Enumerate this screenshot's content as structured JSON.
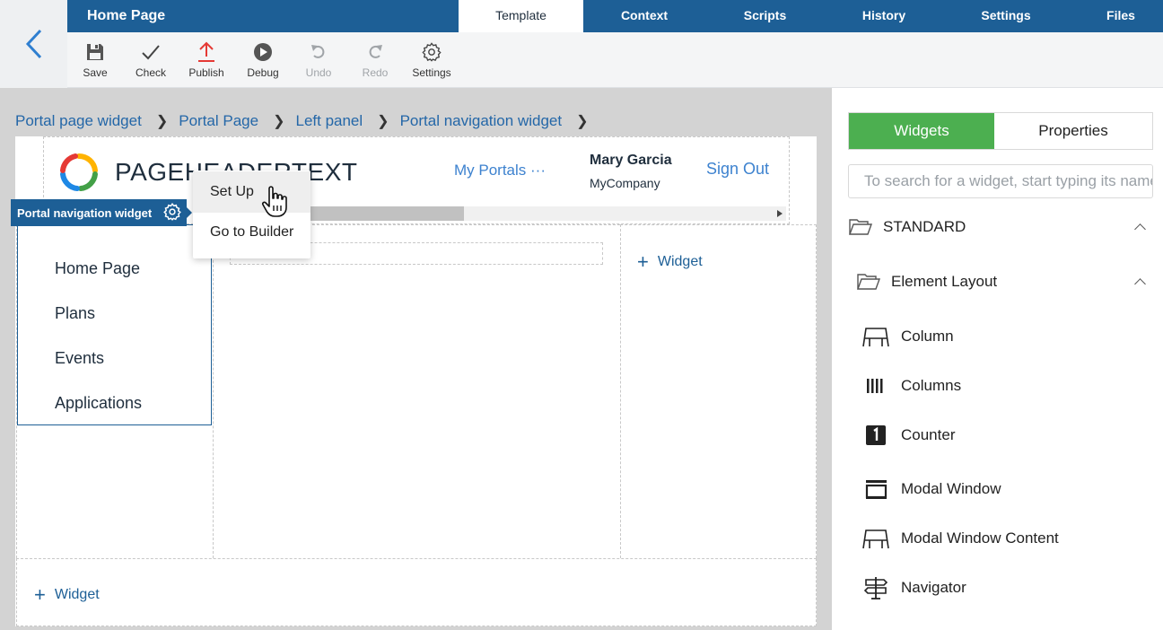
{
  "header": {
    "title": "Home Page",
    "tabs": [
      {
        "label": "Template",
        "active": true
      },
      {
        "label": "Context",
        "active": false
      },
      {
        "label": "Scripts",
        "active": false
      },
      {
        "label": "History",
        "active": false
      },
      {
        "label": "Settings",
        "active": false
      },
      {
        "label": "Files",
        "active": false
      }
    ]
  },
  "toolbar": {
    "save": "Save",
    "check": "Check",
    "publish": "Publish",
    "debug": "Debug",
    "undo": "Undo",
    "redo": "Redo",
    "settings": "Settings"
  },
  "breadcrumb": [
    "Portal page widget",
    "Portal Page",
    "Left panel",
    "Portal navigation widget"
  ],
  "portal_header": {
    "logo_text": "PAGEHEADERTEXT",
    "my_portals": "My Portals ···",
    "user_name": "Mary Garcia",
    "company": "MyCompany",
    "sign_out": "Sign Out"
  },
  "nav_widget": {
    "label": "Portal navigation widget",
    "items": [
      "Home Page",
      "Plans",
      "Events",
      "Applications"
    ]
  },
  "context_menu": {
    "set_up": "Set Up",
    "go_to_builder": "Go to Builder"
  },
  "add_widget_label": "Widget",
  "panel": {
    "tabs": [
      {
        "label": "Widgets",
        "active": true
      },
      {
        "label": "Properties",
        "active": false
      }
    ],
    "search_placeholder": "To search for a widget, start typing its name",
    "group_standard": "STANDARD",
    "group_layout": "Element Layout",
    "widgets": [
      "Column",
      "Columns",
      "Counter",
      "Modal Window",
      "Modal Window Content",
      "Navigator"
    ]
  },
  "colors": {
    "header_blue": "#1d5f96",
    "link_blue": "#3d82cf",
    "accent_green": "#4caf50",
    "publish_red": "#e53935"
  }
}
